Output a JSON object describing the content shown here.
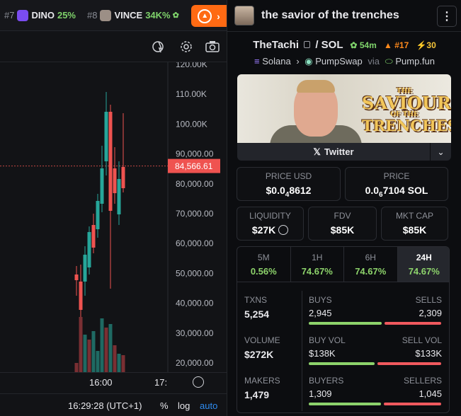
{
  "ticker": [
    {
      "rank": "#7",
      "name": "DINO",
      "change": "25%",
      "avatar_color": "#7a4cf0"
    },
    {
      "rank": "#8",
      "name": "VINCE",
      "change": "34K%",
      "avatar_color": "#9c8f86"
    }
  ],
  "chart": {
    "y_ticks": [
      "120.00K",
      "110.00K",
      "100.00K",
      "90,000.00",
      "80,000.00",
      "70,000.00",
      "60,000.00",
      "50,000.00",
      "40,000.00",
      "30,000.00",
      "20,000.00"
    ],
    "current_price_label": "84,566.61",
    "x_ticks": [
      "16:00",
      "17:"
    ],
    "clock": "16:29:28 (UTC+1)",
    "percent_label": "%",
    "log_label": "log",
    "auto_label": "auto",
    "colors": {
      "up": "#26a69a",
      "down": "#ef5350",
      "price_tag": "#ef5350",
      "auto": "#2f8cf0"
    }
  },
  "header": {
    "title": "the savior of the trenches"
  },
  "pair": {
    "name": "TheTachi",
    "quote": "SOL",
    "age": "54m",
    "rank": "#17",
    "boosts": "30"
  },
  "route": {
    "chain": "Solana",
    "dex": "PumpSwap",
    "via": "via",
    "launchpad": "Pump.fun"
  },
  "banner": {
    "line1": "THE",
    "line2": "SAVIOUR",
    "line3": "OF THE",
    "line4": "TRENCHES"
  },
  "twitter": {
    "label": "Twitter"
  },
  "price_usd": {
    "label": "PRICE USD",
    "prefix": "$0.0",
    "zeros": "4",
    "digits": "8612"
  },
  "price_sol": {
    "label": "PRICE",
    "prefix": "0.0",
    "zeros": "6",
    "digits": "7104 SOL"
  },
  "liquidity": {
    "label": "LIQUIDITY",
    "value": "$27K"
  },
  "fdv": {
    "label": "FDV",
    "value": "$85K"
  },
  "mktcap": {
    "label": "MKT CAP",
    "value": "$85K"
  },
  "timeframes": [
    {
      "label": "5M",
      "value": "0.56%"
    },
    {
      "label": "1H",
      "value": "74.67%"
    },
    {
      "label": "6H",
      "value": "74.67%"
    },
    {
      "label": "24H",
      "value": "74.67%"
    }
  ],
  "stats": {
    "txns": {
      "label": "TXNS",
      "value": "5,254",
      "buys_label": "BUYS",
      "buys": "2,945",
      "sells_label": "SELLS",
      "sells": "2,309",
      "buy_ratio": 0.56
    },
    "volume": {
      "label": "VOLUME",
      "value": "$272K",
      "buys_label": "BUY VOL",
      "buys": "$138K",
      "sells_label": "SELL VOL",
      "sells": "$133K",
      "buy_ratio": 0.51
    },
    "makers": {
      "label": "MAKERS",
      "value": "1,479",
      "buys_label": "BUYERS",
      "buys": "1,309",
      "sells_label": "SELLERS",
      "sells": "1,045",
      "buy_ratio": 0.556
    }
  }
}
